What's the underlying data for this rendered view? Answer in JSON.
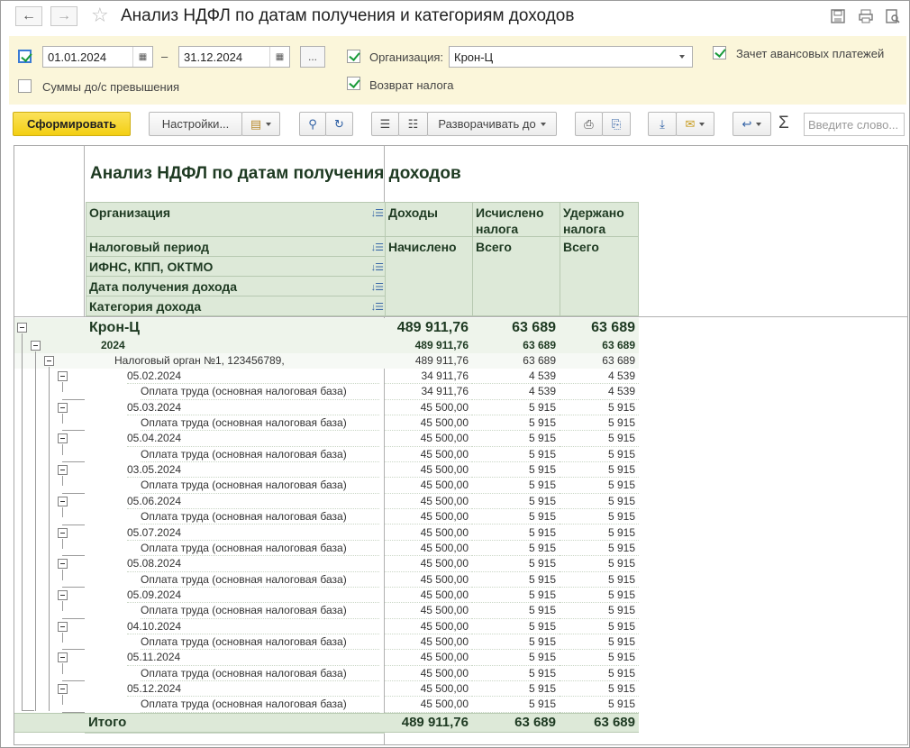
{
  "window": {
    "title": "Анализ НДФЛ по датам получения и категориям доходов"
  },
  "filters": {
    "period_enabled": true,
    "date_from": "01.01.2024",
    "date_separator": "–",
    "date_to": "31.12.2024",
    "date_more_label": "...",
    "org_enabled": true,
    "org_label": "Организация:",
    "org_value": "Крон-Ц",
    "advance_enabled": true,
    "advance_label": "Зачет авансовых платежей",
    "excess_enabled": false,
    "excess_label": "Суммы до/с превышения",
    "refund_enabled": true,
    "refund_label": "Возврат налога"
  },
  "toolbar": {
    "generate": "Сформировать",
    "settings": "Настройки...",
    "expand_to": "Разворачивать до",
    "sigma": "Σ",
    "search_placeholder": "Введите слово..."
  },
  "report": {
    "title": "Анализ НДФЛ по датам получения доходов",
    "group_headers": [
      "Организация",
      "Налоговый период",
      "ИФНС, КПП, ОКТМО",
      "Дата получения дохода",
      "Категория дохода"
    ],
    "col1_top": "Доходы",
    "col1_sub": "Начислено",
    "col2_top": "Исчислено налога",
    "col2_sub": "Всего",
    "col3_top": "Удержано налога",
    "col3_sub": "Всего",
    "org_row": {
      "label": "Крон-Ц",
      "income": "489 911,76",
      "calc": "63 689",
      "withheld": "63 689"
    },
    "year_row": {
      "label": "2024",
      "income": "489 911,76",
      "calc": "63 689",
      "withheld": "63 689"
    },
    "ifns_row": {
      "label": "Налоговый орган №1, 123456789,",
      "income": "489 911,76",
      "calc": "63 689",
      "withheld": "63 689"
    },
    "dates": [
      {
        "date": "05.02.2024",
        "category": "Оплата труда (основная налоговая база)",
        "income": "34 911,76",
        "calc": "4 539",
        "withheld": "4 539"
      },
      {
        "date": "05.03.2024",
        "category": "Оплата труда (основная налоговая база)",
        "income": "45 500,00",
        "calc": "5 915",
        "withheld": "5 915"
      },
      {
        "date": "05.04.2024",
        "category": "Оплата труда (основная налоговая база)",
        "income": "45 500,00",
        "calc": "5 915",
        "withheld": "5 915"
      },
      {
        "date": "03.05.2024",
        "category": "Оплата труда (основная налоговая база)",
        "income": "45 500,00",
        "calc": "5 915",
        "withheld": "5 915"
      },
      {
        "date": "05.06.2024",
        "category": "Оплата труда (основная налоговая база)",
        "income": "45 500,00",
        "calc": "5 915",
        "withheld": "5 915"
      },
      {
        "date": "05.07.2024",
        "category": "Оплата труда (основная налоговая база)",
        "income": "45 500,00",
        "calc": "5 915",
        "withheld": "5 915"
      },
      {
        "date": "05.08.2024",
        "category": "Оплата труда (основная налоговая база)",
        "income": "45 500,00",
        "calc": "5 915",
        "withheld": "5 915"
      },
      {
        "date": "05.09.2024",
        "category": "Оплата труда (основная налоговая база)",
        "income": "45 500,00",
        "calc": "5 915",
        "withheld": "5 915"
      },
      {
        "date": "04.10.2024",
        "category": "Оплата труда (основная налоговая база)",
        "income": "45 500,00",
        "calc": "5 915",
        "withheld": "5 915"
      },
      {
        "date": "05.11.2024",
        "category": "Оплата труда (основная налоговая база)",
        "income": "45 500,00",
        "calc": "5 915",
        "withheld": "5 915"
      },
      {
        "date": "05.12.2024",
        "category": "Оплата труда (основная налоговая база)",
        "income": "45 500,00",
        "calc": "5 915",
        "withheld": "5 915"
      }
    ],
    "total_row": {
      "label": "Итого",
      "income": "489 911,76",
      "calc": "63 689",
      "withheld": "63 689"
    }
  }
}
